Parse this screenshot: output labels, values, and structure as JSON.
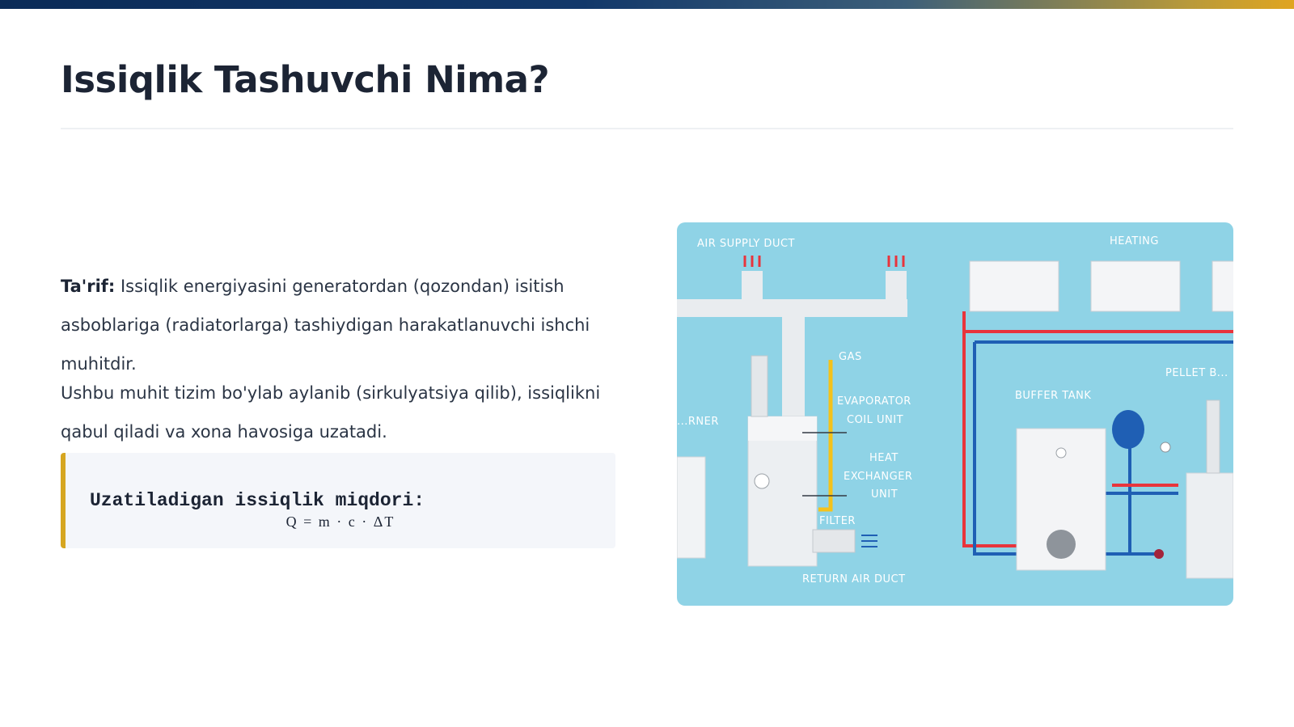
{
  "slide": {
    "title": "Issiqlik Tashuvchi Nima?",
    "definition_label": "Ta'rif:",
    "definition_text": " Issiqlik energiyasini generatordan (qozondan) isitish asboblariga (radiatorlarga) tashiydigan harakatlanuvchi ishchi muhitdir.",
    "paragraph2": "Ushbu muhit tizim bo'ylab aylanib (sirkulyatsiya qilib), issiqlikni qabul qiladi va xona havosiga uzatadi.",
    "formula_label": "Uzatiladigan issiqlik miqdori:",
    "formula": "Q = m · c · ΔT"
  },
  "illustration": {
    "labels": {
      "air_supply_duct": "AIR SUPPLY DUCT",
      "heating": "HEATING",
      "gas": "GAS",
      "evaporator": "EVAPORATOR",
      "coil_unit": "COIL UNIT",
      "heat": "HEAT",
      "exchanger": "EXCHANGER",
      "unit": "UNIT",
      "filter": "FILTER",
      "return_air_duct": "RETURN AIR DUCT",
      "buffer_tank": "BUFFER TANK",
      "pellet": "PELLET B...",
      "burner": "...RNER"
    },
    "colors": {
      "background": "#8fd3e6",
      "hot_pipe": "#e8343c",
      "cold_pipe": "#1f5fb4",
      "gas_pipe": "#f4c21a"
    }
  }
}
